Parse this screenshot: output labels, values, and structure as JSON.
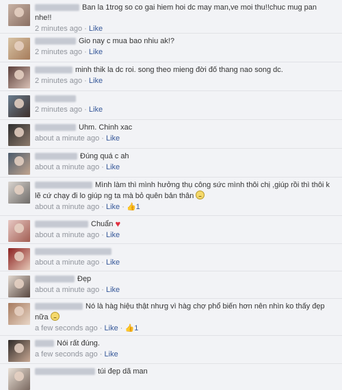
{
  "comments": [
    {
      "text": "Ban la 1trog so co gai hiem hoi dc may man,ve moi thu!!chuc mug pan nhe!!",
      "time": "2 minutes ago",
      "like": "Like"
    },
    {
      "text": "Gio nay c mua bao nhiu ak!?",
      "time": "2 minutes ago",
      "like": "Like"
    },
    {
      "text": "minh thik la dc roi. song theo mieng đời đố thang nao song dc.",
      "time": "2 minutes ago",
      "like": "Like"
    },
    {
      "text": "",
      "time": "2 minutes ago",
      "like": "Like"
    },
    {
      "text": "Uhm. Chinh xac",
      "time": "about a minute ago",
      "like": "Like"
    },
    {
      "text": "Đúng quá c ah",
      "time": "about a minute ago",
      "like": "Like"
    },
    {
      "text": "Mình làm thì mình hưởng thụ công sức mình thôi chị ,giúp rồi thì thôi k lẽ cứ chạy đi lo giúp ng ta mà bỏ quên bản thân",
      "time": "about a minute ago",
      "like": "Like",
      "likes": "1",
      "emoji": "sad-emoji"
    },
    {
      "text": "Chuẩn",
      "time": "about a minute ago",
      "like": "Like",
      "emoji": "heart"
    },
    {
      "text": "",
      "time": "about a minute ago",
      "like": "Like"
    },
    {
      "text": "Đẹp",
      "time": "about a minute ago",
      "like": "Like"
    },
    {
      "text": "Nó là hàg hiệu thật nhưg vì hàg chợ phổ biến hơn nên nhìn ko thấy đẹp nữa",
      "time": "a few seconds ago",
      "like": "Like",
      "likes": "1",
      "emoji": "sad-emoji"
    },
    {
      "text": "Nói rất đúng.",
      "time": "a few seconds ago",
      "like": "Like"
    },
    {
      "text": "túi đẹp dã man",
      "time": "",
      "like": ""
    }
  ],
  "separator": "·",
  "thumb_icon": "👍",
  "colors": {
    "link": "#365899",
    "meta": "#90949c",
    "text": "#333333",
    "background": "#f2f3f6"
  }
}
